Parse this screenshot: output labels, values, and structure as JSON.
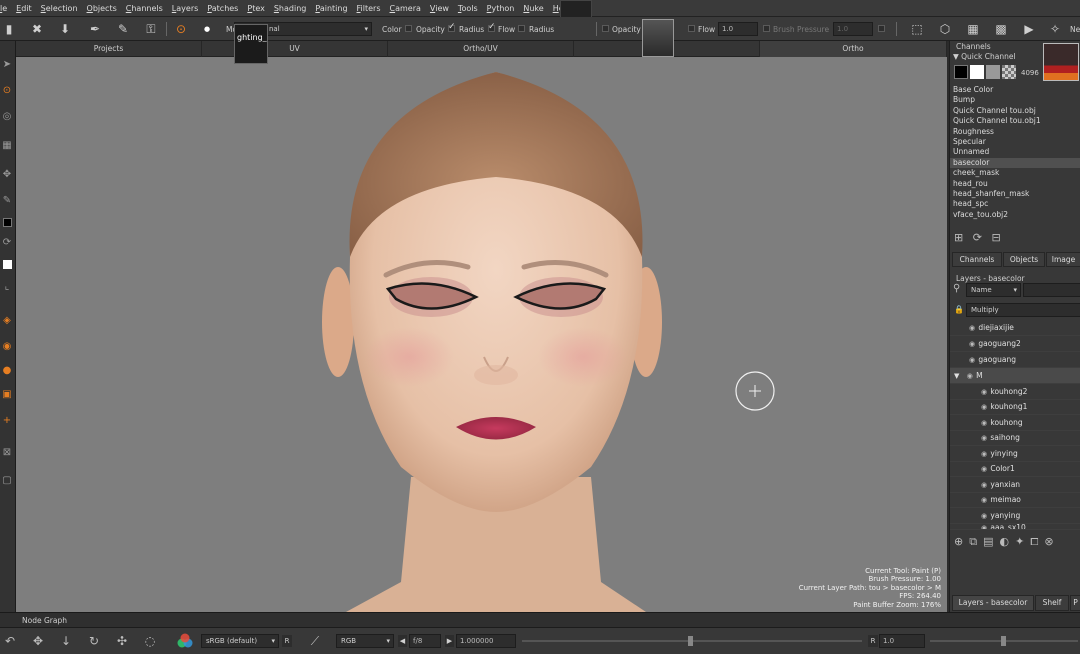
{
  "menu": [
    "le",
    "Edit",
    "Selection",
    "Objects",
    "Channels",
    "Layers",
    "Patches",
    "Ptex",
    "Shading",
    "Painting",
    "Filters",
    "Camera",
    "View",
    "Tools",
    "Python",
    "Nuke",
    "Help"
  ],
  "toolbar": {
    "mode_prefix": "Mo",
    "mode_value": "nal",
    "tooltip_text": "ghting_",
    "color_label": "Color",
    "opacity_label": "Opacity",
    "radius_label": "Radius",
    "flow_label": "Flow",
    "radius2_label": "Radius",
    "opacity2_label": "Opacity",
    "flow2_label": "Flow",
    "flow2_value": "1.0",
    "pressure_label": "Brush Pressure",
    "pressure_value": "1.0",
    "ne_label": "Ne"
  },
  "viewport_tabs": [
    "Projects",
    "UV",
    "Ortho/UV",
    "ive",
    "Ortho"
  ],
  "hud": {
    "line1": "Current Tool: Paint (P)",
    "line2": "Brush Pressure: 1.00",
    "line3": "Current Layer Path: tou > basecolor > M",
    "line4": "FPS: 264.40",
    "line5": "Paint Buffer Zoom: 176%"
  },
  "channels_panel": {
    "title": "Channels",
    "quick_channel": "▼ Quick Channel",
    "size": "4096",
    "items": [
      "Base Color",
      "Bump",
      "Quick Channel tou.obj",
      "Quick Channel tou.obj1",
      "Roughness",
      "Specular",
      "Unnamed",
      "basecolor",
      "cheek_mask",
      "head_rou",
      "head_shanfen_mask",
      "head_spc",
      "vface_tou.obj2"
    ],
    "selected": "basecolor"
  },
  "panel_tabs": [
    "Channels",
    "Objects",
    "Image"
  ],
  "layers_panel": {
    "title": "Layers - basecolor",
    "filter": "Name",
    "blend_mode": "Multiply",
    "top_layers": [
      "diejiaxijie",
      "gaoguang2",
      "gaoguang"
    ],
    "group": "M",
    "sub_layers": [
      "kouhong2",
      "kouhong1",
      "kouhong",
      "saihong",
      "yinying",
      "Color1",
      "yanxian",
      "meimao",
      "yanying",
      "aaa_sx10"
    ]
  },
  "bottom_tabs": [
    "Layers - basecolor",
    "Shelf",
    "P"
  ],
  "nodegraph_label": "Node Graph",
  "bottombar": {
    "colorspace": "sRGB (default)",
    "r_label": "R",
    "channel_mode": "RGB",
    "fstop": "f/8",
    "gain": "1.000000",
    "r2_label": "R",
    "r2_value": "1.0"
  }
}
